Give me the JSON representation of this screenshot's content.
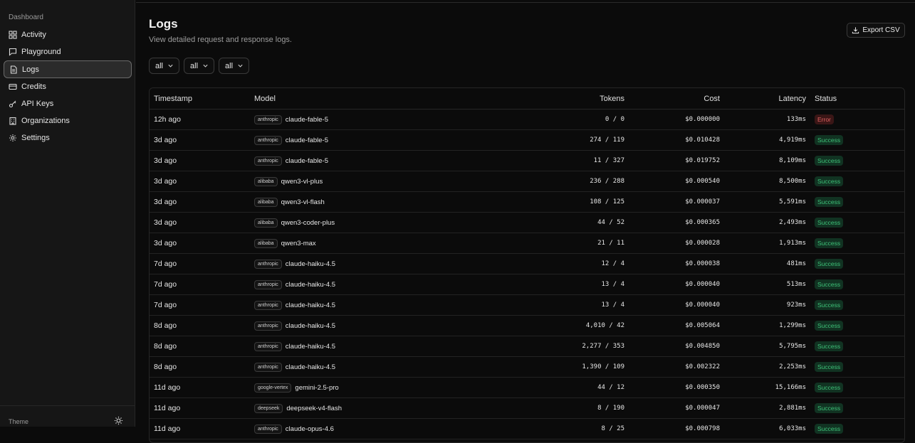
{
  "sidebar": {
    "section_label": "Dashboard",
    "items": [
      {
        "label": "Activity",
        "icon": "grid-icon"
      },
      {
        "label": "Playground",
        "icon": "chat-bubble-icon"
      },
      {
        "label": "Logs",
        "icon": "file-text-icon",
        "active": true
      },
      {
        "label": "Credits",
        "icon": "credit-card-icon"
      },
      {
        "label": "API Keys",
        "icon": "key-icon"
      },
      {
        "label": "Organizations",
        "icon": "building-icon"
      },
      {
        "label": "Settings",
        "icon": "gear-icon"
      }
    ],
    "theme_label": "Theme",
    "theme_icon": "sun-icon"
  },
  "header": {
    "title": "Logs",
    "subtitle": "View detailed request and response logs.",
    "export_label": "Export CSV",
    "export_icon": "download-icon"
  },
  "filters": [
    {
      "value": "all"
    },
    {
      "value": "all"
    },
    {
      "value": "all"
    }
  ],
  "table": {
    "columns": {
      "timestamp": "Timestamp",
      "model": "Model",
      "tokens": "Tokens",
      "cost": "Cost",
      "latency": "Latency",
      "status": "Status"
    },
    "rows": [
      {
        "timestamp": "12h ago",
        "provider": "anthropic",
        "model": "claude-fable-5",
        "tokens": "0 / 0",
        "cost": "$0.000000",
        "latency": "133ms",
        "status": "Error"
      },
      {
        "timestamp": "3d ago",
        "provider": "anthropic",
        "model": "claude-fable-5",
        "tokens": "274 / 119",
        "cost": "$0.010428",
        "latency": "4,919ms",
        "status": "Success"
      },
      {
        "timestamp": "3d ago",
        "provider": "anthropic",
        "model": "claude-fable-5",
        "tokens": "11 / 327",
        "cost": "$0.019752",
        "latency": "8,109ms",
        "status": "Success"
      },
      {
        "timestamp": "3d ago",
        "provider": "alibaba",
        "model": "qwen3-vl-plus",
        "tokens": "236 / 288",
        "cost": "$0.000540",
        "latency": "8,500ms",
        "status": "Success"
      },
      {
        "timestamp": "3d ago",
        "provider": "alibaba",
        "model": "qwen3-vl-flash",
        "tokens": "108 / 125",
        "cost": "$0.000037",
        "latency": "5,591ms",
        "status": "Success"
      },
      {
        "timestamp": "3d ago",
        "provider": "alibaba",
        "model": "qwen3-coder-plus",
        "tokens": "44 / 52",
        "cost": "$0.000365",
        "latency": "2,493ms",
        "status": "Success"
      },
      {
        "timestamp": "3d ago",
        "provider": "alibaba",
        "model": "qwen3-max",
        "tokens": "21 / 11",
        "cost": "$0.000028",
        "latency": "1,913ms",
        "status": "Success"
      },
      {
        "timestamp": "7d ago",
        "provider": "anthropic",
        "model": "claude-haiku-4.5",
        "tokens": "12 / 4",
        "cost": "$0.000038",
        "latency": "481ms",
        "status": "Success"
      },
      {
        "timestamp": "7d ago",
        "provider": "anthropic",
        "model": "claude-haiku-4.5",
        "tokens": "13 / 4",
        "cost": "$0.000040",
        "latency": "513ms",
        "status": "Success"
      },
      {
        "timestamp": "7d ago",
        "provider": "anthropic",
        "model": "claude-haiku-4.5",
        "tokens": "13 / 4",
        "cost": "$0.000040",
        "latency": "923ms",
        "status": "Success"
      },
      {
        "timestamp": "8d ago",
        "provider": "anthropic",
        "model": "claude-haiku-4.5",
        "tokens": "4,010 / 42",
        "cost": "$0.005064",
        "latency": "1,299ms",
        "status": "Success"
      },
      {
        "timestamp": "8d ago",
        "provider": "anthropic",
        "model": "claude-haiku-4.5",
        "tokens": "2,277 / 353",
        "cost": "$0.004850",
        "latency": "5,795ms",
        "status": "Success"
      },
      {
        "timestamp": "8d ago",
        "provider": "anthropic",
        "model": "claude-haiku-4.5",
        "tokens": "1,390 / 109",
        "cost": "$0.002322",
        "latency": "2,253ms",
        "status": "Success"
      },
      {
        "timestamp": "11d ago",
        "provider": "google-vertex",
        "model": "gemini-2.5-pro",
        "tokens": "44 / 12",
        "cost": "$0.000350",
        "latency": "15,166ms",
        "status": "Success"
      },
      {
        "timestamp": "11d ago",
        "provider": "deepseek",
        "model": "deepseek-v4-flash",
        "tokens": "8 / 190",
        "cost": "$0.000047",
        "latency": "2,881ms",
        "status": "Success"
      },
      {
        "timestamp": "11d ago",
        "provider": "anthropic",
        "model": "claude-opus-4.6",
        "tokens": "8 / 25",
        "cost": "$0.000798",
        "latency": "6,033ms",
        "status": "Success"
      }
    ]
  },
  "colors": {
    "success": "#3ec178",
    "error": "#e06161",
    "background": "#0b0b0b",
    "sidebar": "#161616"
  }
}
